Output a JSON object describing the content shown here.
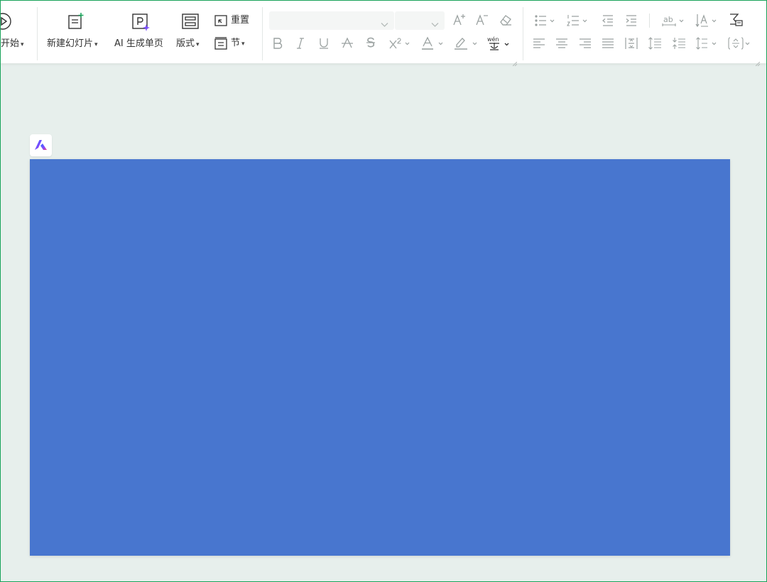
{
  "ribbon": {
    "start": {
      "label": "开始"
    },
    "new_slide": {
      "label": "新建幻灯片"
    },
    "ai_page": {
      "label": "AI 生成单页"
    },
    "layout": {
      "label": "版式"
    },
    "reset": {
      "label": "重置"
    },
    "section": {
      "label": "节"
    },
    "font": {
      "name_value": "",
      "size_value": ""
    }
  },
  "colors": {
    "slide_background": "#4876cf",
    "workspace_background": "#e7efec",
    "window_border": "#19a35a",
    "ai_sparkle": "#7b4dff"
  },
  "icons": {
    "play": "play-circle-icon",
    "new_slide": "new-slide-icon",
    "ai": "ai-page-icon",
    "layout": "layout-icon",
    "reset": "reset-icon",
    "section": "section-icon",
    "grow_font": "increase-font-icon",
    "shrink_font": "decrease-font-icon",
    "clear_format": "eraser-icon",
    "bold": "bold-icon",
    "italic": "italic-icon",
    "underline": "underline-icon",
    "strikethrough": "strikethrough-icon",
    "shadow": "text-shadow-icon",
    "superscript": "superscript-icon",
    "font_color": "font-color-icon",
    "highlight": "highlight-icon",
    "phonetic": "phonetic-guide-icon",
    "bullets": "bullet-list-icon",
    "numbering": "numbered-list-icon",
    "decrease_indent": "decrease-indent-icon",
    "increase_indent": "increase-indent-icon",
    "char_spacing": "character-spacing-icon",
    "text_direction": "text-direction-icon",
    "convert": "convert-text-icon",
    "align_left": "align-left-icon",
    "align_center": "align-center-icon",
    "align_right": "align-right-icon",
    "justify": "justify-icon",
    "distributed": "distributed-icon",
    "line_spacing_up": "line-spacing-icon",
    "line_spacing_down": "paragraph-spacing-icon",
    "line_spacing_menu": "line-spacing-menu-icon",
    "vertical_align": "vertical-align-icon",
    "app_logo": "app-logo-icon"
  }
}
